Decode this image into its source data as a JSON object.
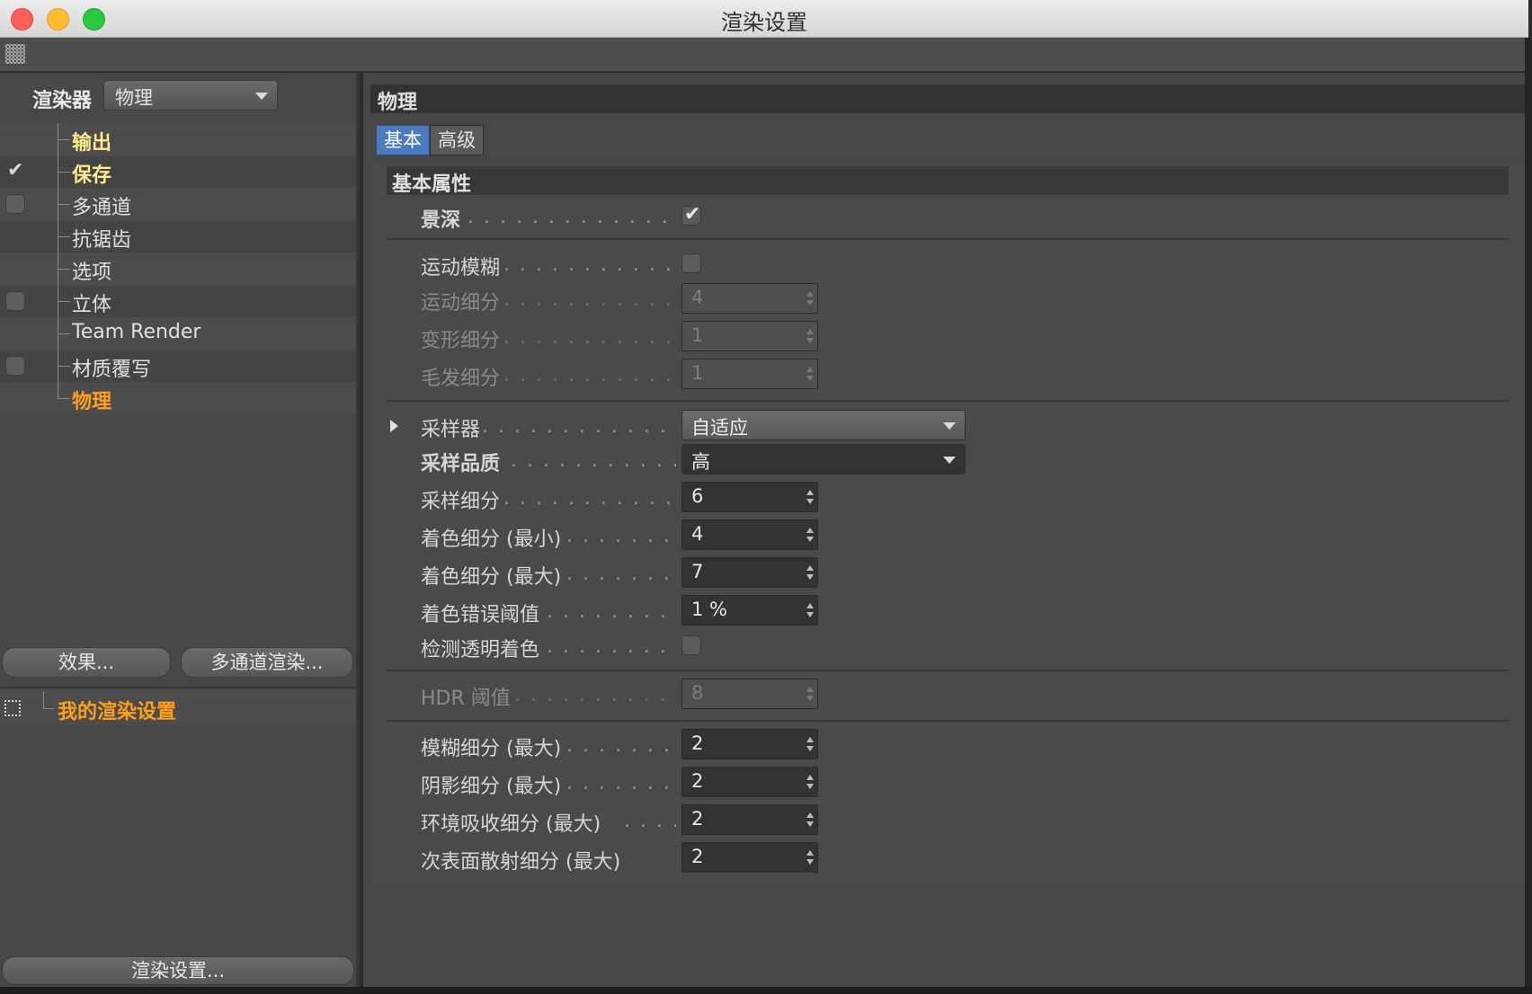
{
  "window": {
    "title": "渲染设置"
  },
  "left": {
    "renderer_label": "渲染器",
    "renderer_value": "物理",
    "tree": [
      {
        "label": "输出",
        "check": "none",
        "style": "bold"
      },
      {
        "label": "保存",
        "check": "checked",
        "style": "bold"
      },
      {
        "label": "多通道",
        "check": "unchecked",
        "style": "normal"
      },
      {
        "label": "抗锯齿",
        "check": "none",
        "style": "normal"
      },
      {
        "label": "选项",
        "check": "none",
        "style": "normal"
      },
      {
        "label": "立体",
        "check": "unchecked",
        "style": "normal"
      },
      {
        "label": "Team Render",
        "check": "none",
        "style": "normal"
      },
      {
        "label": "材质覆写",
        "check": "unchecked",
        "style": "normal"
      },
      {
        "label": "物理",
        "check": "none",
        "style": "active"
      }
    ],
    "effects_button": "效果...",
    "multipass_button": "多通道渲染...",
    "settings_name": "我的渲染设置",
    "render_settings_button": "渲染设置..."
  },
  "right": {
    "panel_title": "物理",
    "tabs": [
      {
        "label": "基本",
        "active": true
      },
      {
        "label": "高级",
        "active": false
      }
    ],
    "section_title": "基本属性",
    "props": {
      "dof": {
        "label": "景深",
        "checked": true
      },
      "motion_blur": {
        "label": "运动模糊",
        "checked": false
      },
      "motion_subdiv": {
        "label": "运动细分",
        "value": "4"
      },
      "deform_subdiv": {
        "label": "变形细分",
        "value": "1"
      },
      "hair_subdiv": {
        "label": "毛发细分",
        "value": "1"
      },
      "sampler": {
        "label": "采样器",
        "value": "自适应"
      },
      "sample_quality": {
        "label": "采样品质",
        "value": "高"
      },
      "sample_subdiv": {
        "label": "采样细分",
        "value": "6"
      },
      "shading_min": {
        "label": "着色细分 (最小)",
        "value": "4"
      },
      "shading_max": {
        "label": "着色细分 (最大)",
        "value": "7"
      },
      "shading_error": {
        "label": "着色错误阈值",
        "value": "1 %"
      },
      "detect_transparent": {
        "label": "检测透明着色",
        "checked": false
      },
      "hdr_threshold": {
        "label": "HDR 阈值",
        "value": "8"
      },
      "blur_subdiv": {
        "label": "模糊细分 (最大)",
        "value": "2"
      },
      "shadow_subdiv": {
        "label": "阴影细分 (最大)",
        "value": "2"
      },
      "ao_subdiv": {
        "label": "环境吸收细分 (最大)",
        "value": "2"
      },
      "sss_subdiv": {
        "label": "次表面散射细分 (最大)",
        "value": "2"
      }
    },
    "dots": ". . . . . . . . . . . . . . . . . . . . . ."
  }
}
